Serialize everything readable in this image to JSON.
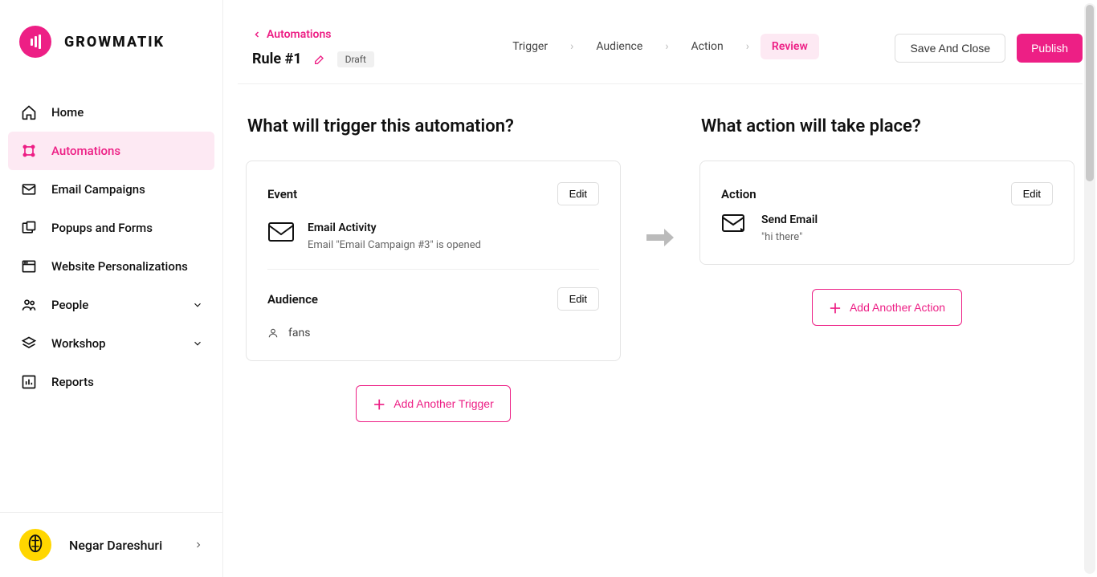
{
  "brand": "GROWMATIK",
  "sidebar": {
    "items": [
      {
        "label": "Home",
        "icon": "home-icon"
      },
      {
        "label": "Automations",
        "icon": "automations-icon",
        "active": true
      },
      {
        "label": "Email Campaigns",
        "icon": "mail-icon"
      },
      {
        "label": "Popups and Forms",
        "icon": "popups-icon"
      },
      {
        "label": "Website Personalizations",
        "icon": "website-icon"
      },
      {
        "label": "People",
        "icon": "people-icon",
        "chevron": true
      },
      {
        "label": "Workshop",
        "icon": "workshop-icon",
        "chevron": true
      },
      {
        "label": "Reports",
        "icon": "reports-icon"
      }
    ]
  },
  "user": {
    "name": "Negar Dareshuri"
  },
  "breadcrumb": {
    "back": "Automations"
  },
  "rule": {
    "title": "Rule #1",
    "status": "Draft"
  },
  "steps": {
    "s1": "Trigger",
    "s2": "Audience",
    "s3": "Action",
    "s4": "Review"
  },
  "buttons": {
    "save": "Save And Close",
    "publish": "Publish",
    "edit": "Edit",
    "add_trigger": "Add Another Trigger",
    "add_action": "Add Another Action"
  },
  "trigger": {
    "heading": "What will trigger this automation?",
    "event_label": "Event",
    "event_title": "Email Activity",
    "event_desc": "Email \"Email Campaign #3\" is opened",
    "audience_label": "Audience",
    "audience_value": "fans"
  },
  "action": {
    "heading": "What action will take place?",
    "card_label": "Action",
    "title": "Send Email",
    "desc": "\"hi there\""
  }
}
